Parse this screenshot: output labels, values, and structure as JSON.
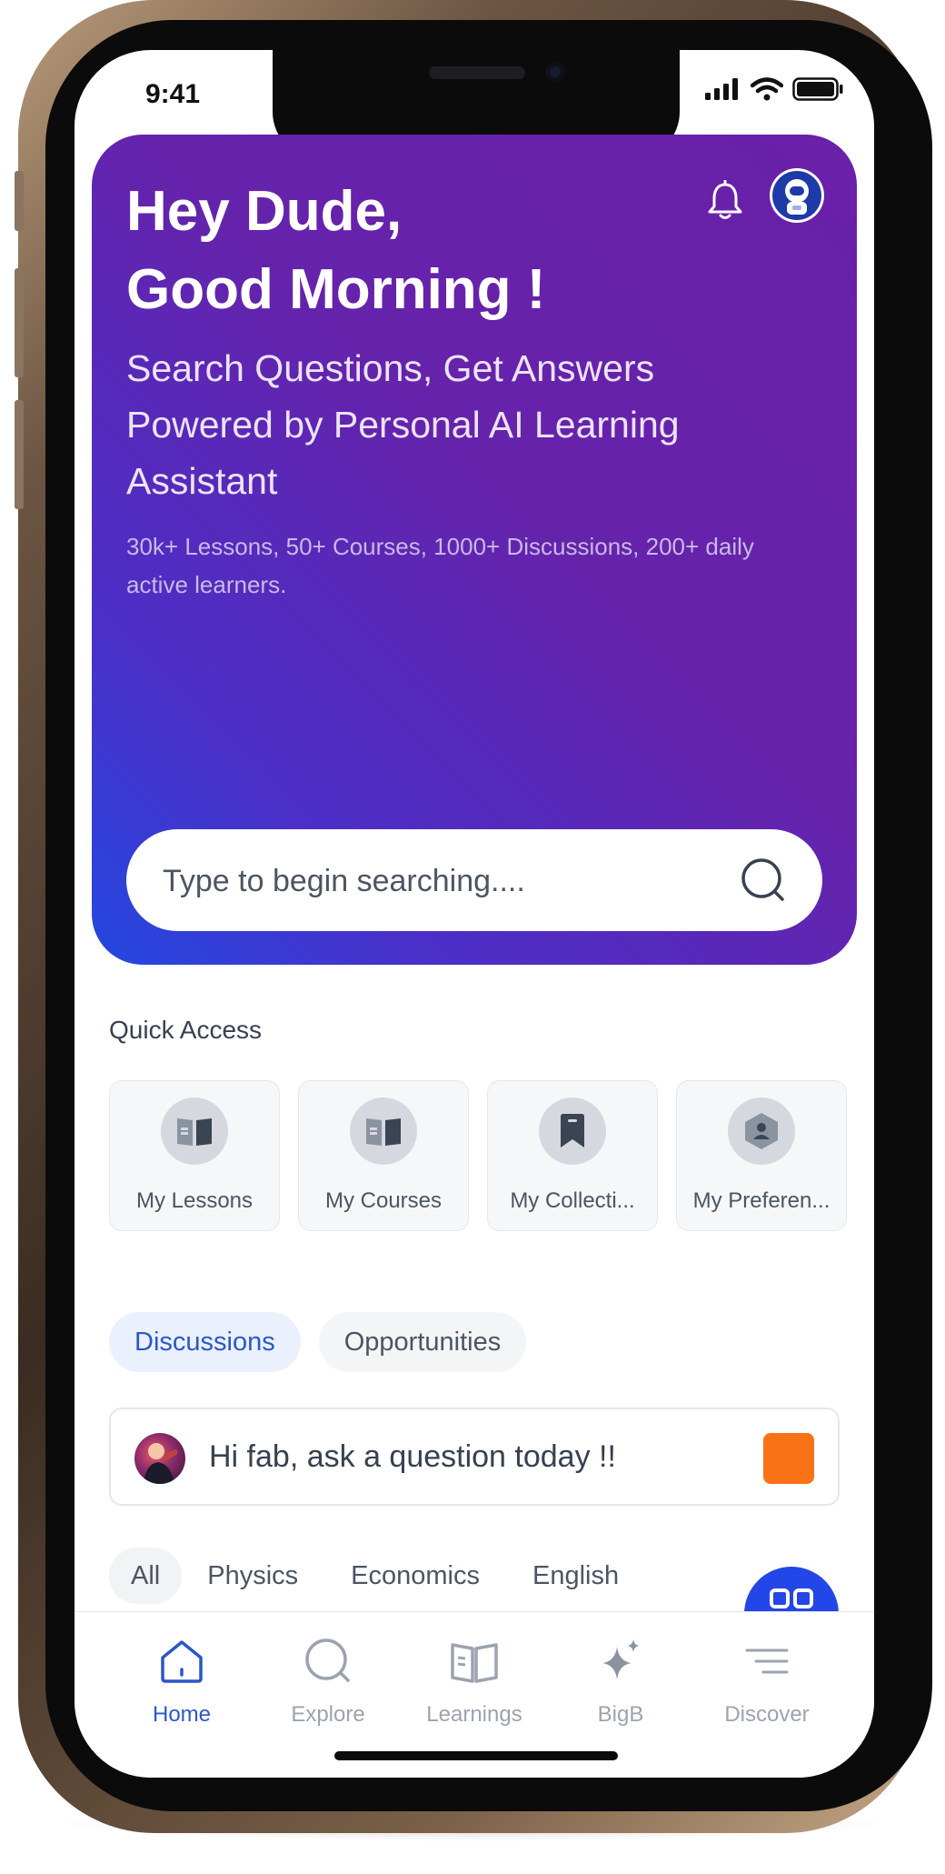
{
  "status_bar": {
    "time": "9:41"
  },
  "hero": {
    "greeting_line1": "Hey Dude,",
    "greeting_line2": "Good Morning !",
    "subtitle": "Search Questions, Get Answers Powered by Personal AI Learning Assistant",
    "stats": "30k+ Lessons, 50+ Courses, 1000+ Discussions, 200+ daily active learners."
  },
  "search": {
    "placeholder": "Type to begin searching...."
  },
  "quick_access": {
    "title": "Quick Access",
    "items": [
      {
        "label": "My Lessons",
        "icon": "book-icon"
      },
      {
        "label": "My Courses",
        "icon": "book-icon"
      },
      {
        "label": "My Collecti...",
        "icon": "bookmark-icon"
      },
      {
        "label": "My Preferen...",
        "icon": "user-hexagon-icon"
      }
    ]
  },
  "tabs": [
    {
      "label": "Discussions",
      "active": true
    },
    {
      "label": "Opportunities",
      "active": false
    }
  ],
  "ask": {
    "prompt": "Hi fab, ask a question today !!"
  },
  "filters": [
    {
      "label": "All",
      "active": true
    },
    {
      "label": "Physics",
      "active": false
    },
    {
      "label": "Economics",
      "active": false
    },
    {
      "label": "English",
      "active": false
    }
  ],
  "bottom_nav": [
    {
      "label": "Home",
      "icon": "home-icon",
      "active": true
    },
    {
      "label": "Explore",
      "icon": "search-icon",
      "active": false
    },
    {
      "label": "Learnings",
      "icon": "open-book-icon",
      "active": false
    },
    {
      "label": "BigB",
      "icon": "sparkle-icon",
      "active": false
    },
    {
      "label": "Discover",
      "icon": "menu-lines-icon",
      "active": false
    }
  ],
  "colors": {
    "accent": "#2b57c7",
    "hero_start": "#6a20a8",
    "hero_end": "#2348e0",
    "ask_button": "#f97316",
    "fab": "#2346e8"
  }
}
